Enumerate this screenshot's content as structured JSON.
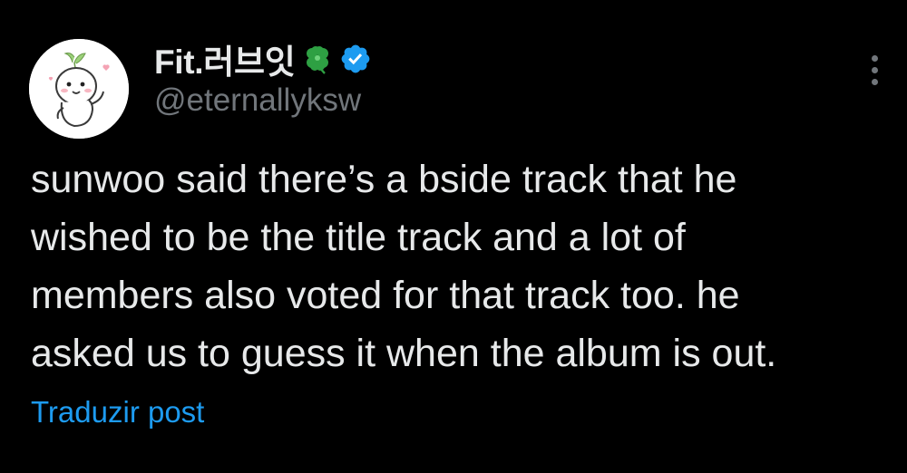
{
  "author": {
    "display_name": "Fit.러브잇",
    "handle": "@eternallyksw",
    "name_emoji_icon": "four-leaf-clover-icon",
    "verified_icon": "verified-badge-icon",
    "avatar_icon": "cartoon-character-avatar"
  },
  "tweet": {
    "text_lines": [
      "sunwoo said there’s a bside track that he",
      "wished to be the title track and a lot of",
      "members also voted for that track too. he",
      "asked us to guess it when the album is out."
    ]
  },
  "actions": {
    "translate_label": "Traduzir post",
    "more_icon": "more-vertical-icon"
  },
  "colors": {
    "background": "#000000",
    "text_primary": "#e7e9ea",
    "text_secondary": "#71767b",
    "link": "#1d9bf0",
    "verified": "#1d9bf0",
    "clover": "#2ea043"
  }
}
